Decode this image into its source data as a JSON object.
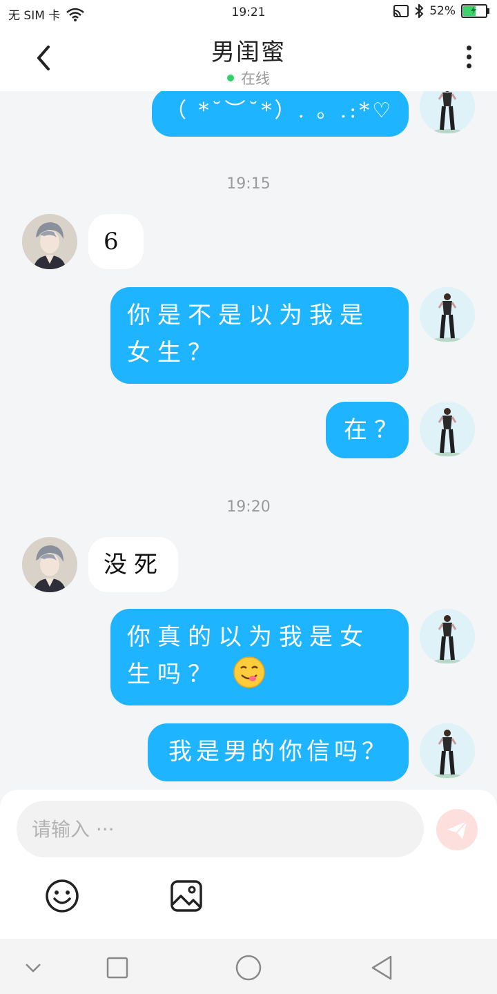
{
  "status_bar": {
    "carrier": "无 SIM 卡",
    "time": "19:21",
    "battery_percent": "52%",
    "icons": [
      "wifi-icon",
      "cast-icon",
      "bluetooth-icon",
      "battery-icon"
    ]
  },
  "header": {
    "title": "男闺蜜",
    "status": "在线",
    "online_color": "#2fd16b"
  },
  "messages": [
    {
      "type": "out",
      "text": "（ *˘︶˘*）. 。.:*♡"
    },
    {
      "type": "time",
      "text": "19:15"
    },
    {
      "type": "in",
      "text": "6"
    },
    {
      "type": "out",
      "text": "你是不是以为我是女生？"
    },
    {
      "type": "out",
      "text": "在？"
    },
    {
      "type": "time",
      "text": "19:20"
    },
    {
      "type": "in",
      "text": "没死"
    },
    {
      "type": "out",
      "text": "你真的以为我是女生吗？",
      "emoji": "yum-emoji-icon"
    },
    {
      "type": "out",
      "text": "我是男的你信吗？"
    }
  ],
  "composer": {
    "placeholder": "请输入 ···",
    "send_color": "#fde0dd",
    "tools": [
      "emoji-icon",
      "image-icon"
    ]
  },
  "colors": {
    "outgoing_bubble": "#1eb4ff",
    "incoming_bubble": "#ffffff",
    "background": "#f4f5f7"
  }
}
